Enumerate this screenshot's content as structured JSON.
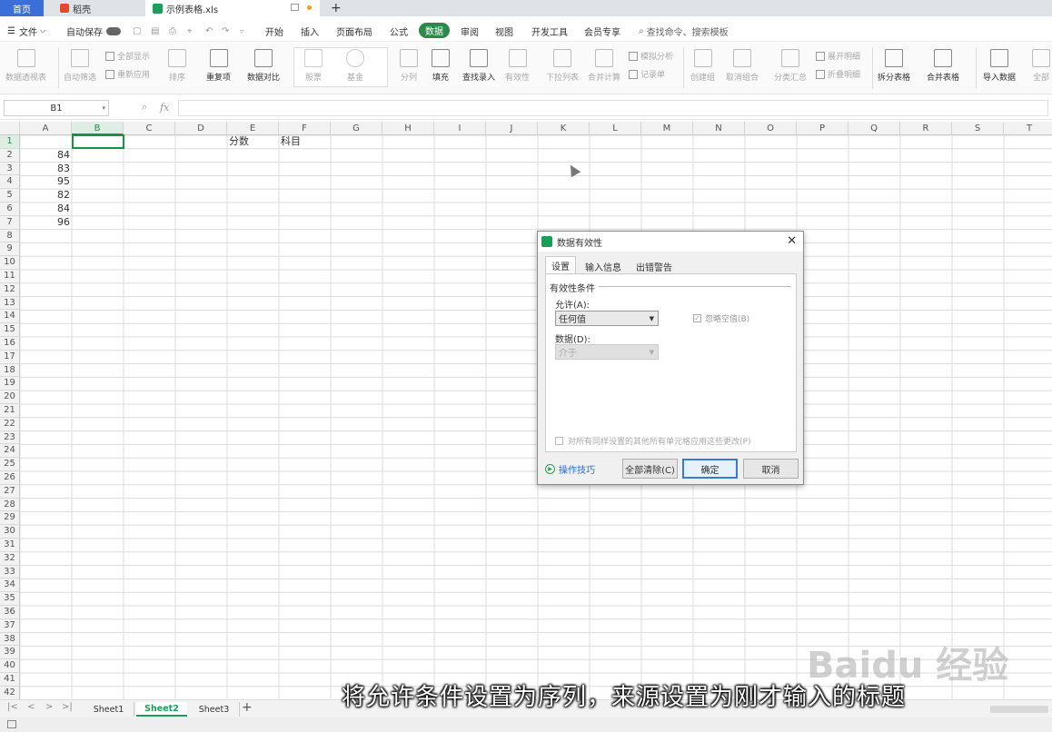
{
  "tabs": {
    "home": "首页",
    "daoke": "稻壳",
    "file": "示例表格.xls",
    "new_tab": "+"
  },
  "menubar": {
    "file_menu": "文件",
    "autosave": "自动保存",
    "items": [
      "开始",
      "插入",
      "页面布局",
      "公式",
      "数据",
      "审阅",
      "视图",
      "开发工具",
      "会员专享"
    ],
    "active": "数据",
    "search_placeholder": "查找命令、搜索模板"
  },
  "ribbon": {
    "pivot": "数据透视表",
    "autofilter": "自动筛选",
    "show_all": "全部显示",
    "reapply": "重新应用",
    "sort": "排序",
    "duplicates": "重复项",
    "compare": "数据对比",
    "stock": "股票",
    "fund": "基金",
    "split": "分列",
    "fill": "填充",
    "find_input": "查找录入",
    "validity": "有效性",
    "dropdown_list": "下拉列表",
    "merge_calc": "合并计算",
    "simulate": "模拟分析",
    "record": "记录单",
    "create_group": "创建组",
    "ungroup": "取消组合",
    "subtotal": "分类汇总",
    "expand": "展开明细",
    "collapse": "折叠明细",
    "split_table": "拆分表格",
    "merge_table": "合并表格",
    "import": "导入数据",
    "all": "全部"
  },
  "formula": {
    "namebox": "B1",
    "fx": "fx",
    "value": ""
  },
  "columns": [
    "A",
    "B",
    "C",
    "D",
    "E",
    "F",
    "G",
    "H",
    "I",
    "J",
    "K",
    "L",
    "M",
    "N",
    "O",
    "P",
    "Q",
    "R",
    "S",
    "T"
  ],
  "rows": [
    "1",
    "2",
    "3",
    "4",
    "5",
    "6",
    "7",
    "8",
    "9",
    "10",
    "11",
    "12",
    "13",
    "14",
    "15",
    "16",
    "17",
    "18",
    "19",
    "20",
    "21",
    "22",
    "23",
    "24",
    "25",
    "26",
    "27",
    "28",
    "29",
    "30",
    "31",
    "32",
    "33",
    "34",
    "35",
    "36",
    "37",
    "38",
    "39",
    "40",
    "41",
    "42"
  ],
  "cells": {
    "E1": "分数",
    "F1": "科目",
    "A2": "84",
    "A3": "83",
    "A4": "95",
    "A5": "82",
    "A6": "84",
    "A7": "96"
  },
  "sheets": [
    "Sheet1",
    "Sheet2",
    "Sheet3"
  ],
  "active_sheet": "Sheet2",
  "dialog": {
    "title": "数据有效性",
    "tabs": [
      "设置",
      "输入信息",
      "出错警告"
    ],
    "section": "有效性条件",
    "allow_label": "允许(A):",
    "allow_value": "任何值",
    "ignore_blank": "忽略空值(B)",
    "data_label": "数据(D):",
    "data_value": "介于",
    "apply_all": "对所有同样设置的其他所有单元格应用这些更改(P)",
    "tips": "操作技巧",
    "clear_all": "全部清除(C)",
    "ok": "确定",
    "cancel": "取消"
  },
  "subtitle": "将允许条件设置为序列，来源设置为刚才输入的标题",
  "watermark": "Baidu 经验",
  "colors": {
    "accent": "#1e9c5a",
    "active_tab": "#2b8a4a",
    "selection": "#1e8f46"
  }
}
